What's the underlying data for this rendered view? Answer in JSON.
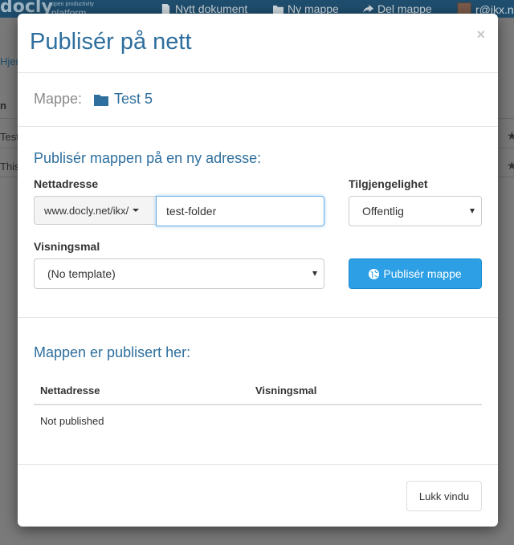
{
  "app": {
    "logo_text": "docly",
    "logo_tagline": "open productivity",
    "logo_sub": "platform",
    "toolbar": {
      "new_document": "Nytt dokument",
      "new_folder": "Ny mappe",
      "share_folder": "Del mappe",
      "user": "r@ikx.n"
    },
    "background": {
      "breadcrumb": "Hjem",
      "column_letter": "n",
      "row1": "Test",
      "row2": "This"
    }
  },
  "modal": {
    "title": "Publisér på nett",
    "close_symbol": "×",
    "folder_label": "Mappe:",
    "folder_name": "Test 5",
    "publish_heading": "Publisér mappen på en ny adresse:",
    "url_label": "Nettadresse",
    "url_prefix": "www.docly.net/ikx/",
    "url_value": "test-folder",
    "access_label": "Tilgjengelighet",
    "access_value": "Offentlig",
    "template_label": "Visningsmal",
    "template_value": "(No template)",
    "publish_button": "Publisér mappe",
    "published_heading": "Mappen er publisert her:",
    "table": {
      "headers": [
        "Nettadresse",
        "Visningsmal"
      ],
      "rows": [
        "Not published"
      ]
    },
    "close_window_button": "Lukk vindu"
  }
}
